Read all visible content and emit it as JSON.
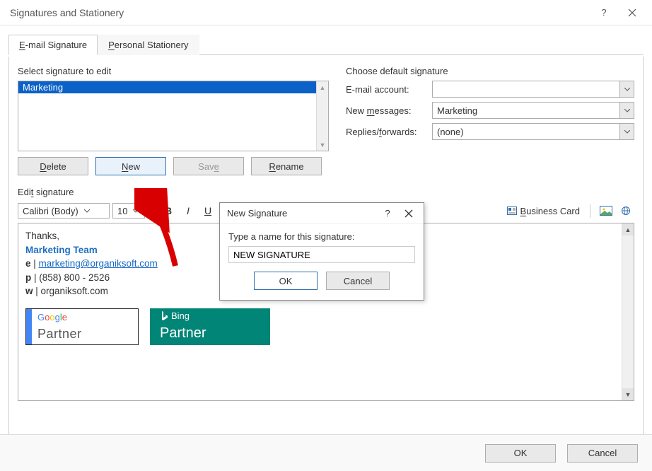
{
  "window": {
    "title": "Signatures and Stationery"
  },
  "tabs": {
    "email_sig": "E-mail Signature",
    "stationery": "Personal Stationery"
  },
  "left": {
    "select_label": "Select signature to edit",
    "list": [
      "Marketing"
    ],
    "buttons": {
      "delete": "Delete",
      "new": "New",
      "save": "Save",
      "rename": "Rename"
    }
  },
  "right": {
    "section": "Choose default signature",
    "email_account_label": "E-mail account:",
    "email_account_value": "",
    "new_messages_label": "New messages:",
    "new_messages_value": "Marketing",
    "replies_label": "Replies/forwards:",
    "replies_value": "(none)"
  },
  "editor": {
    "label": "Edit signature",
    "font": "Calibri (Body)",
    "size": "10",
    "business_card": "Business Card",
    "sig": {
      "thanks": "Thanks,",
      "team": "Marketing Team",
      "e_prefix": "e | ",
      "e_link": "marketing@organiksoft.com",
      "p": "p | (858) 800 - 2526",
      "w": "w | organiksoft.com",
      "google": "Google",
      "google_partner": "Partner",
      "bing": "Bing",
      "bing_partner": "Partner"
    }
  },
  "footer": {
    "ok": "OK",
    "cancel": "Cancel"
  },
  "modal": {
    "title": "New Signature",
    "prompt": "Type a name for this signature:",
    "value": "NEW SIGNATURE",
    "ok": "OK",
    "cancel": "Cancel"
  }
}
